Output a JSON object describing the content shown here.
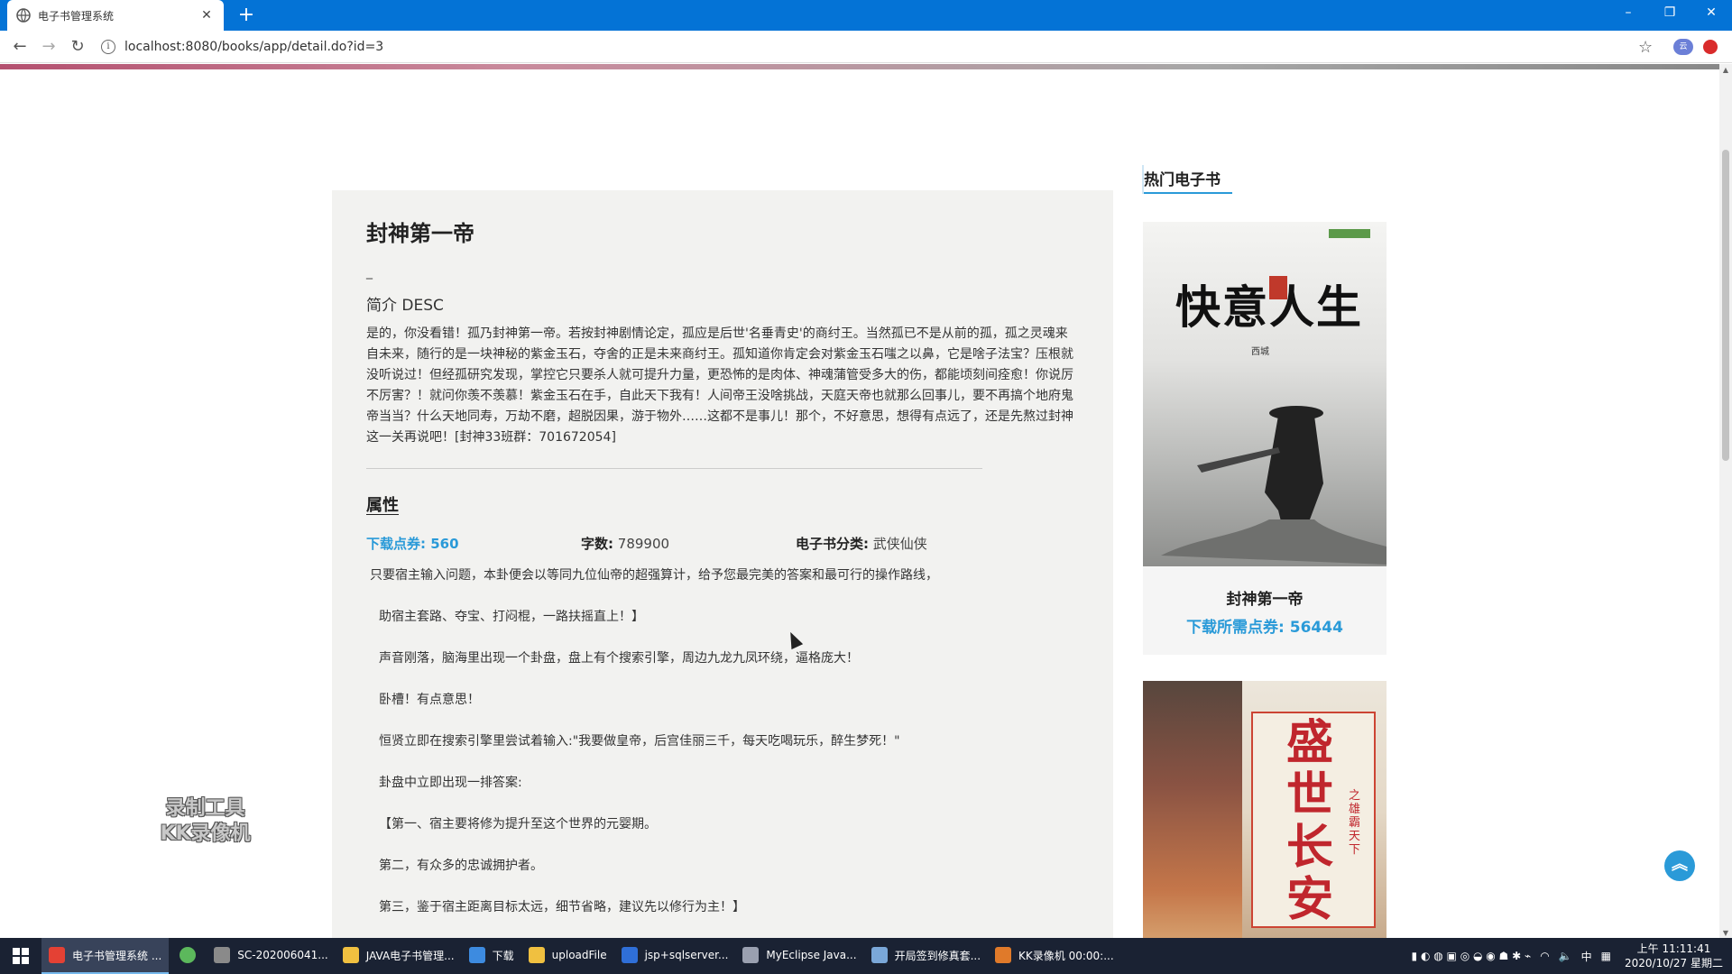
{
  "browser": {
    "tab_title": "电子书管理系统",
    "tab_close": "✕",
    "new_tab": "+",
    "url": "localhost:8080/books/app/detail.do?id=3",
    "win_minimize": "–",
    "win_restore": "❐",
    "win_close": "✕"
  },
  "book": {
    "title": "封神第一帝",
    "dash": "_",
    "desc_heading": "简介 DESC",
    "description": "是的，你没看错！孤乃封神第一帝。若按封神剧情论定，孤应是后世'名垂青史'的商纣王。当然孤已不是从前的孤，孤之灵魂来自未来，随行的是一块神秘的紫金玉石，夺舍的正是未来商纣王。孤知道你肯定会对紫金玉石嗤之以鼻，它是啥子法宝？压根就没听说过！但经孤研究发现，掌控它只要杀人就可提升力量，更恐怖的是肉体、神魂蒲管受多大的伤，都能顷刻间痊愈！你说厉不厉害？！就问你羡不羡慕！紫金玉石在手，自此天下我有！人间帝王没啥挑战，天庭天帝也就那么回事儿，要不再搞个地府鬼帝当当？什么天地同寿，万劫不磨，超脱因果，游于物外……这都不是事儿！那个，不好意思，想得有点远了，还是先熬过封神这一关再说吧！[封神33班群：701672054]",
    "attr_heading": "属性",
    "points_text": "下载点券: 560",
    "words_label": "字数:",
    "words_value": "789900",
    "category_label": "电子书分类:",
    "category_value": "武侠仙侠",
    "content_lines": [
      "只要宿主输入问题，本卦便会以等同九位仙帝的超强算计，给予您最完美的答案和最可行的操作路线，",
      "助宿主套路、夺宝、打闷棍，一路扶摇直上！】",
      "声音刚落，脑海里出现一个卦盘，盘上有个搜索引擎，周边九龙九凤环绕，逼格庞大！",
      "卧槽！有点意思！",
      "恒贤立即在搜索引擎里尝试着输入:\"我要做皇帝，后宫佳丽三千，每天吃喝玩乐，醉生梦死！\"",
      "卦盘中立即出现一排答案:",
      "【第一、宿主要将修为提升至这个世界的元婴期。",
      "第二，有众多的忠诚拥护者。",
      "第三，鉴于宿主距离目标太远，细节省略，建议先以修行为主！】"
    ]
  },
  "sidebar": {
    "heading": "热门电子书",
    "cards": [
      {
        "cover_title": "快意人生",
        "cover_author": "西城",
        "name": "封神第一帝",
        "price": "下载所需点券: 56444"
      },
      {
        "cover_title": "盛世长安",
        "cover_subtitle": "之雄霸天下",
        "name": "",
        "price": ""
      }
    ]
  },
  "watermark": {
    "line1": "录制工具",
    "line2": "KK录像机"
  },
  "taskbar": {
    "items": [
      {
        "label": "电子书管理系统 ...",
        "color": "#e44134",
        "active": true
      },
      {
        "label": "",
        "color": "#5cb85c",
        "active": false
      },
      {
        "label": "SC-202006041...",
        "color": "#8a8a8a",
        "active": false
      },
      {
        "label": "JAVA电子书管理...",
        "color": "#f0c040",
        "active": false
      },
      {
        "label": "下载",
        "color": "#3d8be0",
        "active": false
      },
      {
        "label": "uploadFile",
        "color": "#f0c040",
        "active": false
      },
      {
        "label": "jsp+sqlserver...",
        "color": "#2f6fd8",
        "active": false
      },
      {
        "label": "MyEclipse Java...",
        "color": "#9aa0b0",
        "active": false
      },
      {
        "label": "开局签到修真套...",
        "color": "#7aa7d8",
        "active": false
      },
      {
        "label": "KK录像机 00:00:...",
        "color": "#e07a2a",
        "active": false
      }
    ],
    "time": "上午 11:11:41",
    "date": "2020/10/27 星期二",
    "ime": "中"
  }
}
